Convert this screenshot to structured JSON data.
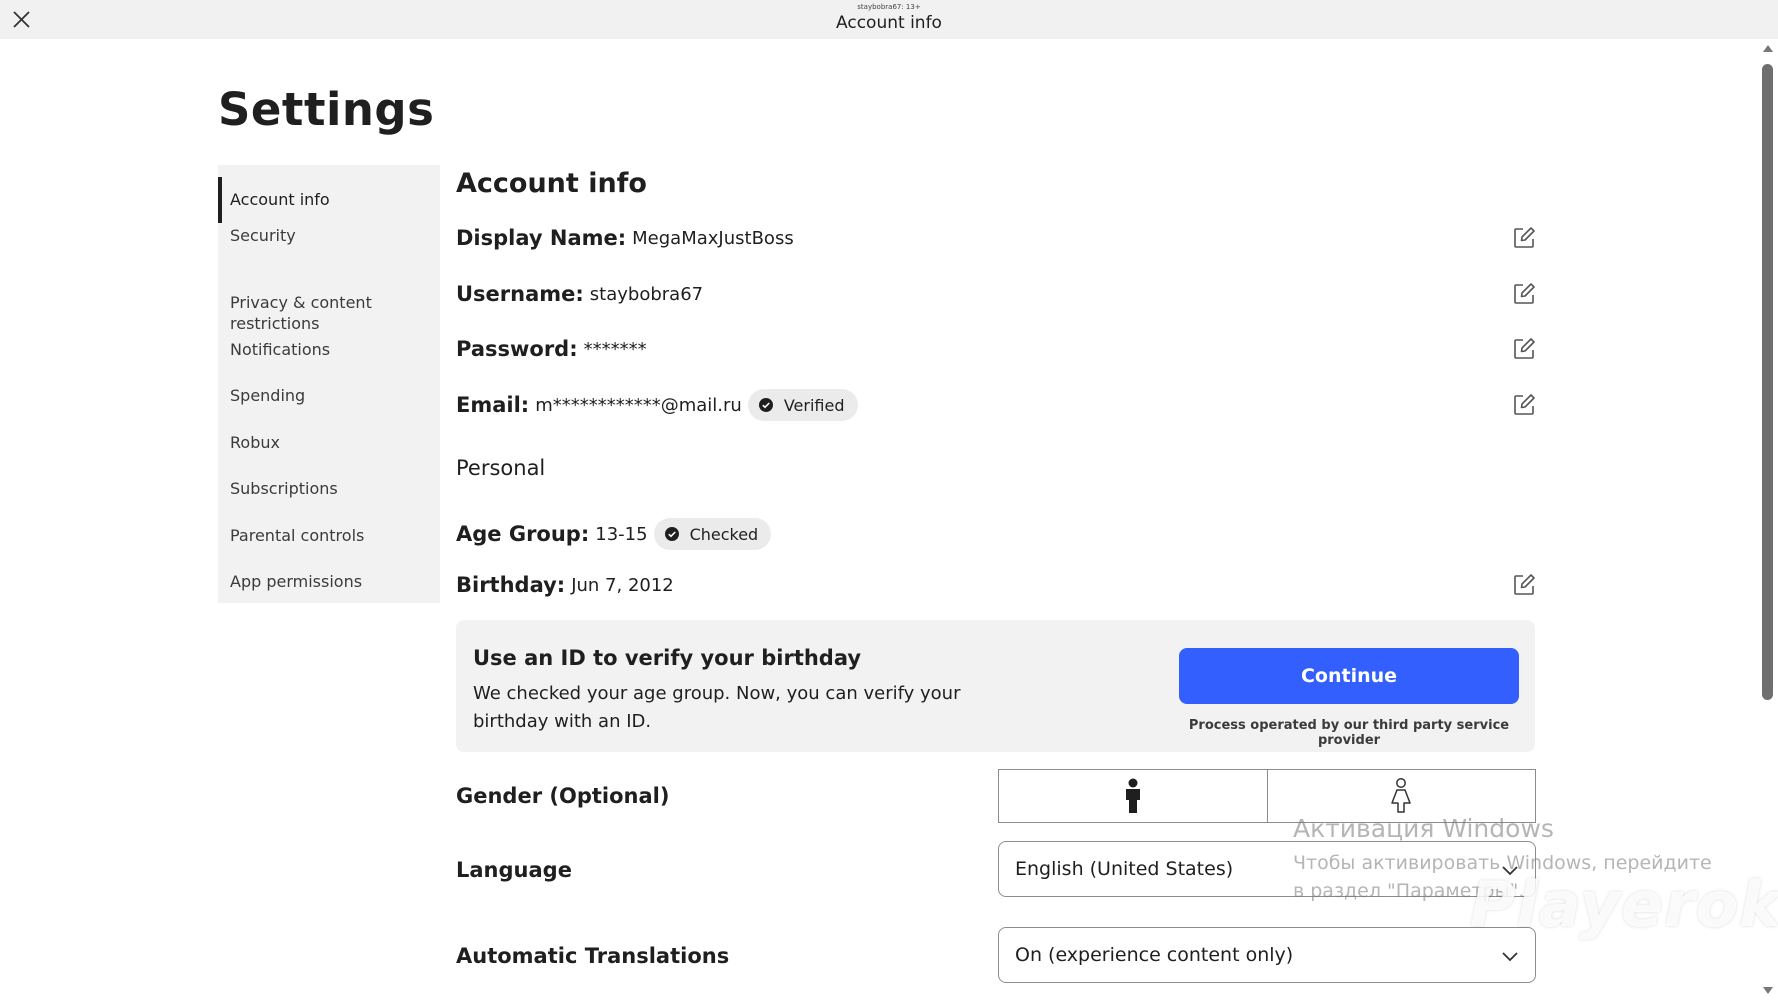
{
  "window": {
    "subtitle": "staybobra67: 13+",
    "title": "Account info",
    "close_icon": "close-icon"
  },
  "page": {
    "title": "Settings"
  },
  "sidebar": {
    "items": [
      {
        "label": "Account info",
        "active": true
      },
      {
        "label": "Security"
      },
      {
        "label": "Privacy & content\nrestrictions"
      },
      {
        "label": "Notifications"
      },
      {
        "label": "Spending"
      },
      {
        "label": "Robux"
      },
      {
        "label": "Subscriptions"
      },
      {
        "label": "Parental controls"
      },
      {
        "label": "App permissions"
      }
    ]
  },
  "account": {
    "title": "Account info",
    "display_name": {
      "label": "Display Name:",
      "value": "MegaMaxJustBoss"
    },
    "username": {
      "label": "Username:",
      "value": "staybobra67"
    },
    "password": {
      "label": "Password:",
      "value": "*******"
    },
    "email": {
      "label": "Email:",
      "value": "m************@mail.ru",
      "badge": "Verified"
    },
    "personal_heading": "Personal",
    "age_group": {
      "label": "Age Group:",
      "value": "13-15",
      "badge": "Checked"
    },
    "birthday": {
      "label": "Birthday:",
      "value": "Jun 7, 2012"
    }
  },
  "verify": {
    "title": "Use an ID to verify your birthday",
    "text": "We checked your age group. Now, you can verify your birthday with an ID.",
    "button": "Continue",
    "note": "Process operated by our third party service provider"
  },
  "gender": {
    "label": "Gender (Optional)",
    "options": [
      "male-icon",
      "female-icon"
    ],
    "selected": "male"
  },
  "language": {
    "label": "Language",
    "value": "English (United States)"
  },
  "translations": {
    "label": "Automatic Translations",
    "value": "On (experience content only)"
  },
  "watermarks": {
    "windows_title": "Активация Windows",
    "windows_text": "Чтобы активировать Windows, перейдите в раздел \"Параметры\".",
    "logo": "Playerok"
  },
  "colors": {
    "primary_button": "#335fff",
    "sidebar_bg": "#f2f2f3",
    "badge_bg": "#ebebec"
  }
}
